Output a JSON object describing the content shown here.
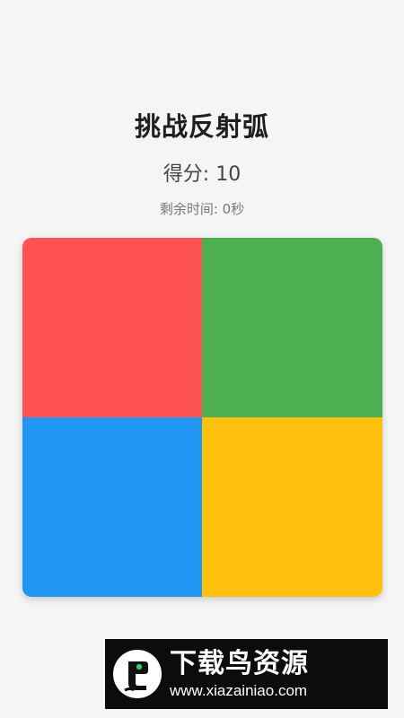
{
  "game": {
    "title": "挑战反射弧",
    "score_text": "得分: 10",
    "timer_text": "剩余时间: 0秒"
  },
  "board": {
    "tiles": [
      {
        "name": "red",
        "color": "#ff5252"
      },
      {
        "name": "green",
        "color": "#4caf50"
      },
      {
        "name": "blue",
        "color": "#2196f3"
      },
      {
        "name": "yellow",
        "color": "#ffc10e"
      }
    ]
  },
  "watermark": {
    "brand": "下载鸟资源",
    "url": "www.xiazainiao.com",
    "logo_icon": "bird-logo-icon"
  }
}
